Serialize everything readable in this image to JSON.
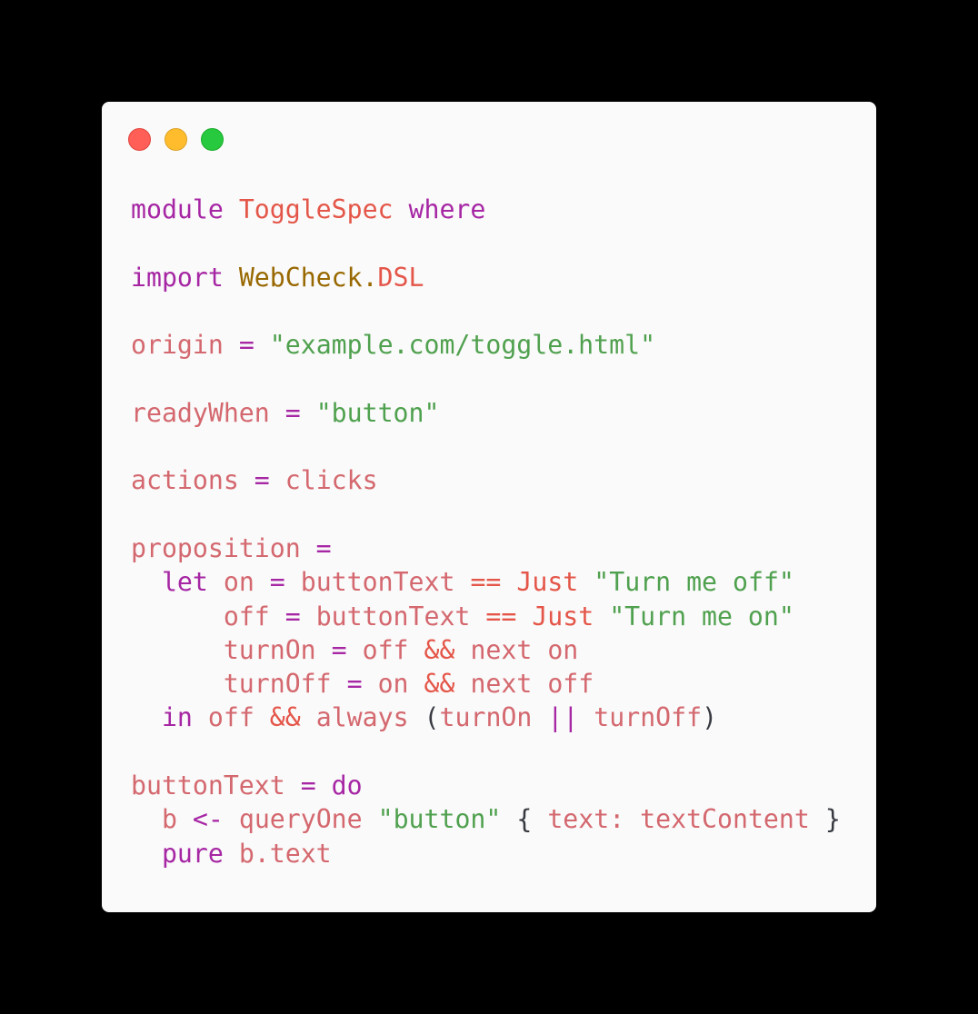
{
  "window": {
    "controls": {
      "close": "red",
      "minimize": "yellow",
      "maximize": "green"
    }
  },
  "colors": {
    "background": "#000000",
    "window": "#fafafa",
    "keyword": "#a626a4",
    "identifier": "#d4686f",
    "string": "#50a14f",
    "constructor": "#e45649",
    "namespace": "#986801",
    "punctuation": "#383a42"
  },
  "code": {
    "l1": {
      "a": "module",
      "b": "ToggleSpec",
      "c": "where"
    },
    "l3": {
      "a": "import",
      "b": "WebCheck.",
      "c": "DSL"
    },
    "l5": {
      "a": "origin",
      "b": "=",
      "c": "\"example.com/toggle.html\""
    },
    "l7": {
      "a": "readyWhen",
      "b": "=",
      "c": "\"button\""
    },
    "l9": {
      "a": "actions",
      "b": "=",
      "c": "clicks"
    },
    "l11": {
      "a": "proposition",
      "b": "="
    },
    "l12": {
      "a": "let",
      "b": "on",
      "c": "=",
      "d": "buttonText",
      "e": "==",
      "f": "Just",
      "g": "\"Turn me off\""
    },
    "l13": {
      "a": "off",
      "b": "=",
      "c": "buttonText",
      "d": "==",
      "e": "Just",
      "f": "\"Turn me on\""
    },
    "l14": {
      "a": "turnOn",
      "b": "=",
      "c": "off",
      "d": "&&",
      "e": "next",
      "f": "on"
    },
    "l15": {
      "a": "turnOff",
      "b": "=",
      "c": "on",
      "d": "&&",
      "e": "next",
      "f": "off"
    },
    "l16": {
      "a": "in",
      "b": "off",
      "c": "&&",
      "d": "always",
      "e": "(",
      "f": "turnOn",
      "g": "||",
      "h": "turnOff",
      "i": ")"
    },
    "l18": {
      "a": "buttonText",
      "b": "=",
      "c": "do"
    },
    "l19": {
      "a": "b",
      "b": "<-",
      "c": "queryOne",
      "d": "\"button\"",
      "e": "{",
      "f": "text:",
      "g": "textContent",
      "h": "}"
    },
    "l20": {
      "a": "pure",
      "b": "b.text"
    }
  }
}
